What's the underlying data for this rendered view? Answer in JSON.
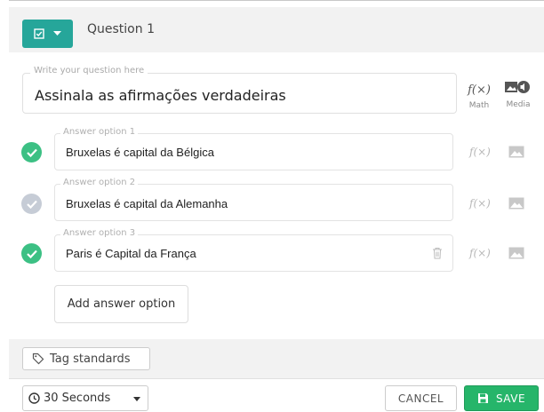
{
  "header": {
    "question_label": "Question 1",
    "type_icon": "checkbox-icon",
    "dropdown_icon": "caret-down-icon"
  },
  "question": {
    "placeholder": "Write your question here",
    "text": "Assinala as afirmações verdadeiras"
  },
  "tools": {
    "math_glyph": "f(×)",
    "math_label": "Math",
    "media_label": "Media"
  },
  "options": [
    {
      "legend": "Answer option 1",
      "text": "Bruxelas é capital da Bélgica",
      "correct": true
    },
    {
      "legend": "Answer option 2",
      "text": "Bruxelas é capital da Alemanha",
      "correct": false
    },
    {
      "legend": "Answer option 3",
      "text": "Paris é Capital da França",
      "correct": true
    }
  ],
  "option_fx": "f(×)",
  "add_option_label": "Add answer option",
  "tag_label": "Tag standards",
  "footer": {
    "time_label": "30 Seconds",
    "cancel_label": "CANCEL",
    "save_label": "SAVE"
  },
  "colors": {
    "teal": "#26a69a",
    "correct_green": "#3cc084",
    "save_green": "#26b56a",
    "incorrect_gray": "#c6ccd6"
  }
}
